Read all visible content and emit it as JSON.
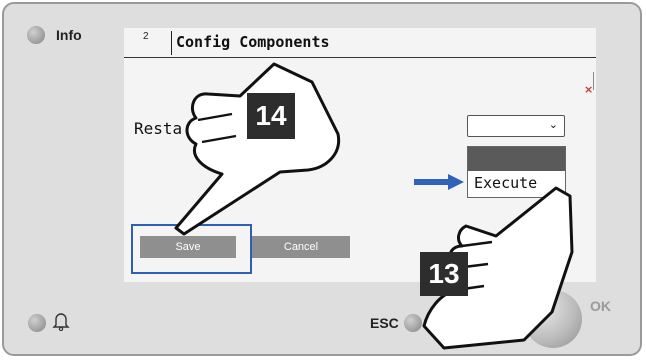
{
  "device": {
    "info_label": "Info",
    "esc_label": "ESC",
    "ok_label": "OK"
  },
  "screen": {
    "page_number": "2",
    "title": "Config Components",
    "close_symbol": "×",
    "restart_label_visible": "Resta",
    "dropdown": {
      "selected_value": "",
      "options": [
        "",
        "Execute"
      ],
      "highlighted_option": "Execute"
    },
    "buttons": {
      "save": "Save",
      "cancel": "Cancel"
    }
  },
  "annotations": {
    "step_a": "14",
    "step_b": "13"
  },
  "colors": {
    "highlight_box": "#2f5fb3",
    "arrow": "#2f62b8",
    "close_mark": "#c0392b",
    "button": "#8f8f8f"
  },
  "icons": [
    "bell-icon",
    "chevron-down-icon",
    "close-icon",
    "right-arrow-icon",
    "pointing-hand-icon"
  ]
}
